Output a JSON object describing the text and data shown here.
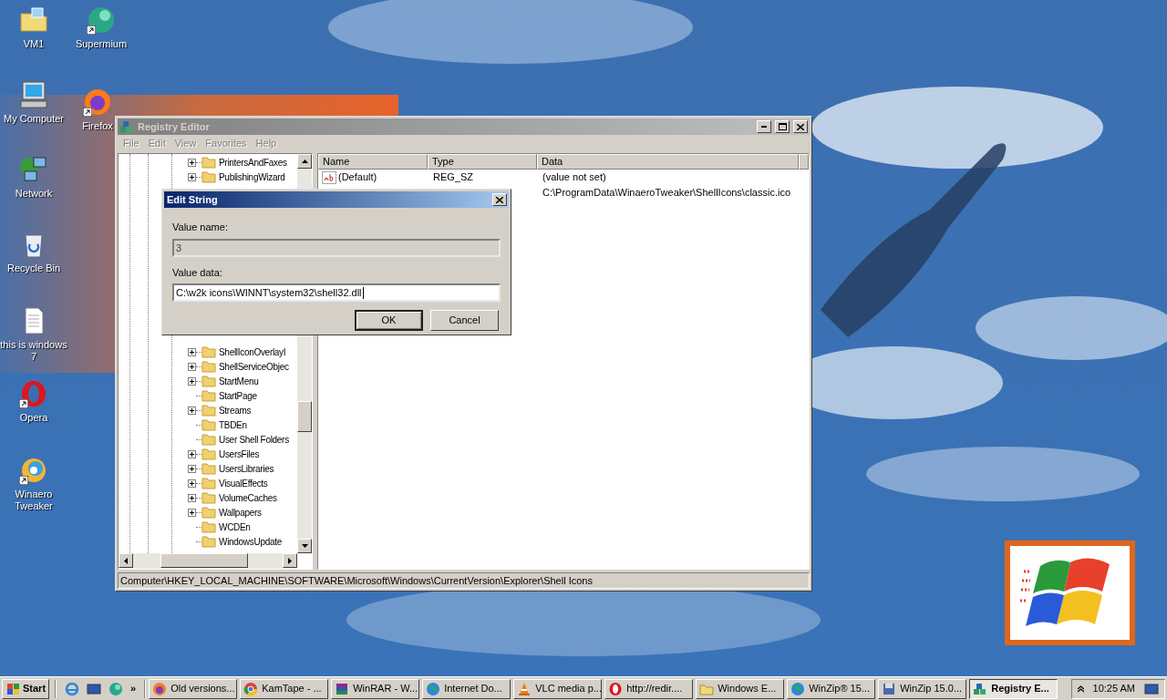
{
  "desktop_icons": [
    {
      "label": "VM1",
      "kind": "folder",
      "shortcut": false
    },
    {
      "label": "Supermium",
      "kind": "orb",
      "shortcut": true
    },
    {
      "label": "My Computer",
      "kind": "computer",
      "shortcut": false
    },
    {
      "label": "Firefox",
      "kind": "ring",
      "shortcut": true
    },
    {
      "label": "Network",
      "kind": "network",
      "shortcut": false
    },
    {
      "label": "Recycle Bin",
      "kind": "bin",
      "shortcut": false
    },
    {
      "label": "this is windows 7",
      "kind": "document",
      "shortcut": false
    },
    {
      "label": "Opera",
      "kind": "opera",
      "shortcut": true
    },
    {
      "label": "Winaero Tweaker",
      "kind": "swirl",
      "shortcut": true
    }
  ],
  "registry_window": {
    "title": "Registry Editor",
    "active": false,
    "menu": [
      {
        "label": "File",
        "disabled": true
      },
      {
        "label": "Edit",
        "disabled": true
      },
      {
        "label": "View",
        "disabled": true
      },
      {
        "label": "Favorites",
        "disabled": true
      },
      {
        "label": "Help",
        "disabled": true
      }
    ],
    "tree_top": [
      {
        "label": "PrintersAndFaxes",
        "has_children": true
      },
      {
        "label": "PublishingWizard",
        "has_children": true
      }
    ],
    "tree_bottom": [
      {
        "label": "ShellIconOverlayI",
        "has_children": true
      },
      {
        "label": "ShellServiceObjec",
        "has_children": true
      },
      {
        "label": "StartMenu",
        "has_children": true
      },
      {
        "label": "StartPage",
        "has_children": false
      },
      {
        "label": "Streams",
        "has_children": true
      },
      {
        "label": "TBDEn",
        "has_children": false
      },
      {
        "label": "User Shell Folders",
        "has_children": false
      },
      {
        "label": "UsersFiles",
        "has_children": true
      },
      {
        "label": "UsersLibraries",
        "has_children": true
      },
      {
        "label": "VisualEffects",
        "has_children": true
      },
      {
        "label": "VolumeCaches",
        "has_children": true
      },
      {
        "label": "Wallpapers",
        "has_children": true
      },
      {
        "label": "WCDEn",
        "has_children": false
      },
      {
        "label": "WindowsUpdate",
        "has_children": false
      }
    ],
    "columns": [
      "Name",
      "Type",
      "Data"
    ],
    "rows": [
      {
        "name": "(Default)",
        "type": "REG_SZ",
        "data": "(value not set)"
      },
      {
        "data": "C:\\ProgramData\\WinaeroTweaker\\ShellIcons\\classic.ico"
      }
    ],
    "status_bar": "Computer\\HKEY_LOCAL_MACHINE\\SOFTWARE\\Microsoft\\Windows\\CurrentVersion\\Explorer\\Shell Icons"
  },
  "dialog": {
    "title": "Edit String",
    "name_label": "Value name:",
    "name_value": "3",
    "name_disabled": true,
    "data_label": "Value data:",
    "data_value": "C:\\w2k icons\\WINNT\\system32\\shell32.dll",
    "buttons": [
      {
        "label": "OK",
        "default": true
      },
      {
        "label": "Cancel",
        "default": false
      }
    ]
  },
  "taskbar": {
    "start": "Start",
    "more": "»",
    "quick_launch": [
      {
        "kind": "ie"
      },
      {
        "kind": "desktop"
      },
      {
        "kind": "orb"
      }
    ],
    "tasks": [
      {
        "label": "Old versions...",
        "kind": "ring",
        "selected": false
      },
      {
        "label": "KamTape - ...",
        "kind": "chrome",
        "selected": false
      },
      {
        "label": "WinRAR - W...",
        "kind": "books",
        "selected": false
      },
      {
        "label": "Internet Do...",
        "kind": "globe",
        "selected": false
      },
      {
        "label": "VLC media p...",
        "kind": "cone",
        "selected": false
      },
      {
        "label": "http://redir....",
        "kind": "opera",
        "selected": false
      },
      {
        "label": "Windows E...",
        "kind": "folder",
        "selected": false
      },
      {
        "label": "WinZip® 15...",
        "kind": "globe",
        "selected": false
      },
      {
        "label": "WinZip 15.0...",
        "kind": "disk",
        "selected": false
      },
      {
        "label": "Registry E...",
        "kind": "cubes",
        "selected": true
      }
    ],
    "clock": "10:25 AM"
  }
}
